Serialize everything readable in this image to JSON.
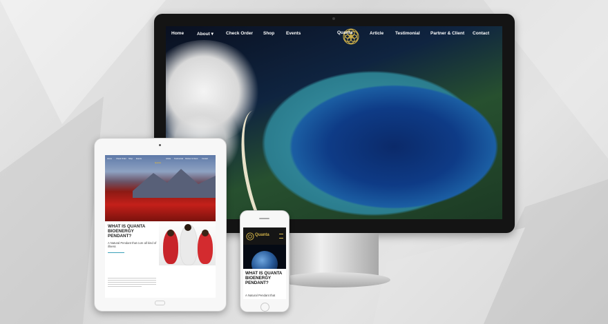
{
  "desktop": {
    "nav_left": [
      "Home",
      "About ▾",
      "Check Order",
      "Shop",
      "Events"
    ],
    "nav_right": [
      "Article",
      "Testimonial",
      "Partner & Client",
      "Contact"
    ],
    "logo_text": "Quanta"
  },
  "tablet": {
    "nav": [
      "Home",
      "Check Order",
      "Shop",
      "Events",
      "Article",
      "Testimonial",
      "Partner & Client",
      "Contact"
    ],
    "logo_text": "Quanta",
    "heading": "WHAT IS QUANTA BIOENERGY PENDANT?",
    "subheading": "A Natural Pendant that cure all kind of illness"
  },
  "phone": {
    "logo_text": "Quanta",
    "heading": "WHAT IS QUANTA BIOENERGY PENDANT?",
    "subheading": "A Natural Pendant that"
  },
  "colors": {
    "gold": "#d4b44a",
    "teal_rule": "#3aa0b8",
    "bezel": "#141414"
  }
}
